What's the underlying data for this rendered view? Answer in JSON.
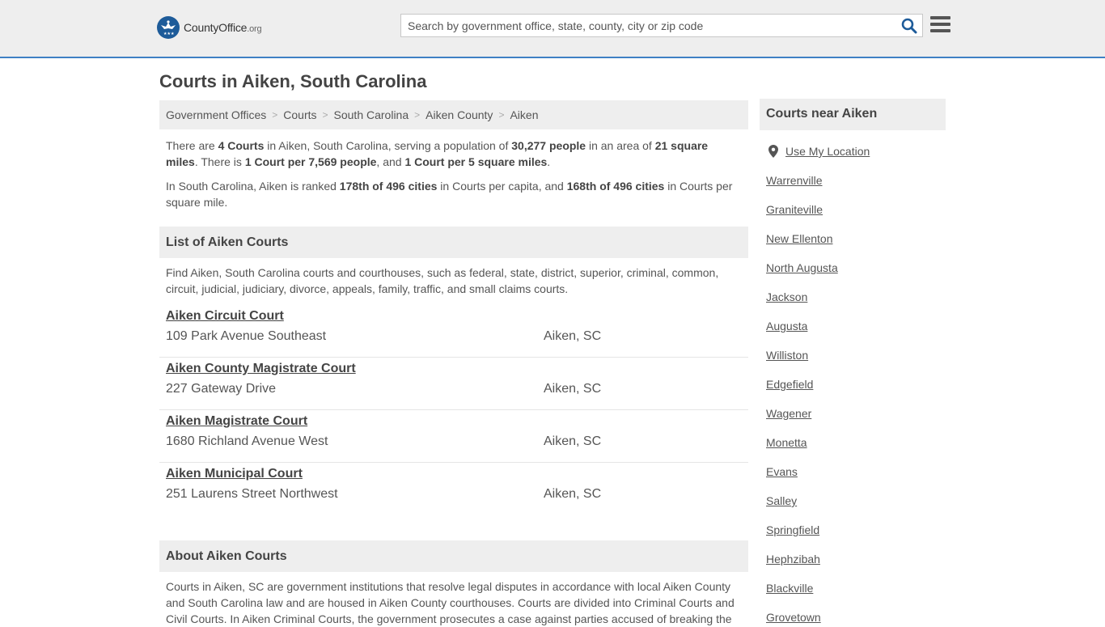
{
  "header": {
    "logo_main": "CountyOffice",
    "logo_tld": ".org",
    "search_placeholder": "Search by government office, state, county, city or zip code"
  },
  "page_title": "Courts in Aiken, South Carolina",
  "breadcrumb": [
    "Government Offices",
    "Courts",
    "South Carolina",
    "Aiken County",
    "Aiken"
  ],
  "intro": {
    "p1": {
      "t1": "There are ",
      "b1": "4 Courts",
      "t2": " in Aiken, South Carolina, serving a population of ",
      "b2": "30,277 people",
      "t3": " in an area of ",
      "b3": "21 square miles",
      "t4": ". There is ",
      "b4": "1 Court per 7,569 people",
      "t5": ", and ",
      "b5": "1 Court per 5 square miles",
      "t6": "."
    },
    "p2": {
      "t1": "In South Carolina, Aiken is ranked ",
      "b1": "178th of 496 cities",
      "t2": " in Courts per capita, and ",
      "b2": "168th of 496 cities",
      "t3": " in Courts per square mile."
    }
  },
  "list_section": {
    "title": "List of Aiken Courts",
    "description": "Find Aiken, South Carolina courts and courthouses, such as federal, state, district, superior, criminal, common, circuit, judicial, judiciary, divorce, appeals, family, traffic, and small claims courts."
  },
  "courts": [
    {
      "name": "Aiken Circuit Court",
      "address": "109 Park Avenue Southeast",
      "city": "Aiken, SC"
    },
    {
      "name": "Aiken County Magistrate Court",
      "address": "227 Gateway Drive",
      "city": "Aiken, SC"
    },
    {
      "name": "Aiken Magistrate Court",
      "address": "1680 Richland Avenue West",
      "city": "Aiken, SC"
    },
    {
      "name": "Aiken Municipal Court",
      "address": "251 Laurens Street Northwest",
      "city": "Aiken, SC"
    }
  ],
  "about_section": {
    "title": "About Aiken Courts",
    "text": "Courts in Aiken, SC are government institutions that resolve legal disputes in accordance with local Aiken County and South Carolina law and are housed in Aiken County courthouses. Courts are divided into Criminal Courts and Civil Courts. In Aiken Criminal Courts, the government prosecutes a case against parties accused of breaking the"
  },
  "sidebar": {
    "title": "Courts near Aiken",
    "use_location": "Use My Location",
    "cities": [
      "Warrenville",
      "Graniteville",
      "New Ellenton",
      "North Augusta",
      "Jackson",
      "Augusta",
      "Williston",
      "Edgefield",
      "Wagener",
      "Monetta",
      "Evans",
      "Salley",
      "Springfield",
      "Hephzibah",
      "Blackville",
      "Grovetown"
    ]
  },
  "colors": {
    "header_bg": "#eeeeee",
    "accent": "#3f80c4",
    "logo_blue": "#1d5b99",
    "search_icon": "#1d5b99"
  }
}
